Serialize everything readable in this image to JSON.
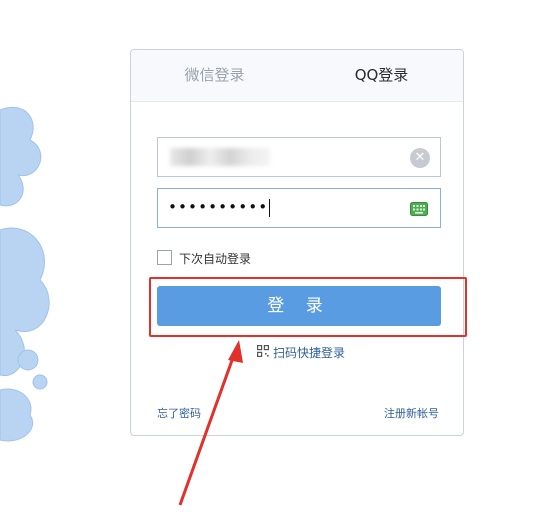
{
  "tabs": [
    {
      "label": "微信登录",
      "active": false
    },
    {
      "label": "QQ登录",
      "active": true
    }
  ],
  "form": {
    "username_value": "",
    "password_mask": "••••••••••",
    "remember_label": "下次自动登录",
    "remember_checked": false,
    "login_button_label": "登 录",
    "qr_login_label": "扫码快捷登录",
    "forgot_label": "忘了密码",
    "register_label": "注册新帐号"
  },
  "icons": [
    "clear-icon",
    "keyboard-icon",
    "qr-code-icon"
  ],
  "colors": {
    "button": "#5a9ce2",
    "link": "#2f5f9b",
    "highlight": "#e2302a",
    "decoration": "#b8d4f2"
  }
}
